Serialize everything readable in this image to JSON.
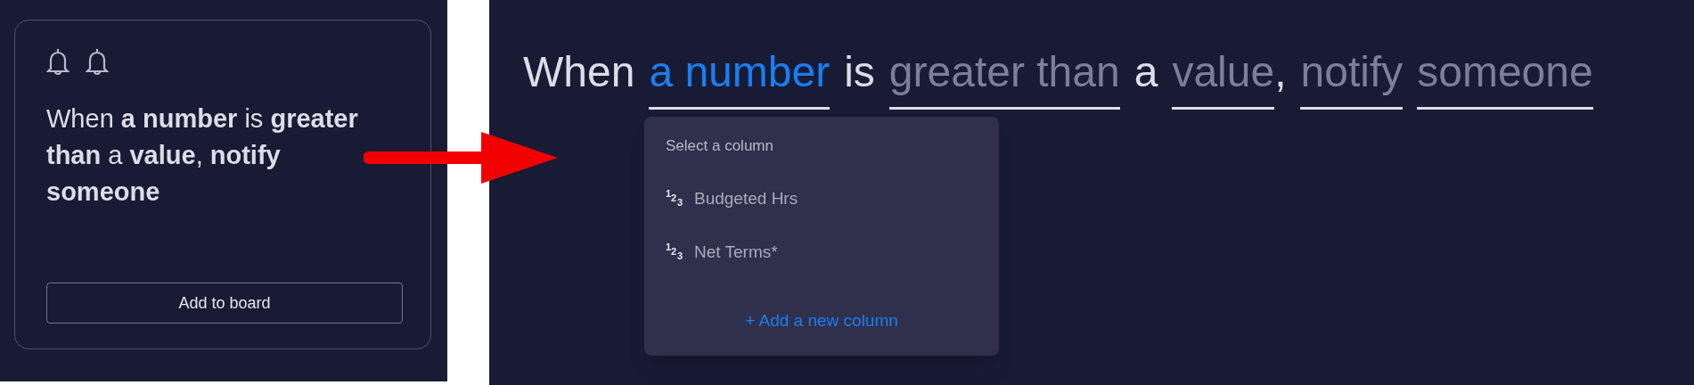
{
  "recipe_card": {
    "text": "When **a number** is **greater than** a **value**, **notify someone**",
    "button": "Add to board"
  },
  "sentence": [
    {
      "kind": "text",
      "text": "When"
    },
    {
      "kind": "field",
      "text": "a number",
      "selected": true
    },
    {
      "kind": "text",
      "text": "is"
    },
    {
      "kind": "field",
      "text": "greater than",
      "selected": false
    },
    {
      "kind": "text",
      "text": "a"
    },
    {
      "kind": "field",
      "text": "value",
      "suffix": ",",
      "selected": false
    },
    {
      "kind": "field",
      "text": "notify",
      "selected": false
    },
    {
      "kind": "field",
      "text": "someone",
      "selected": false
    }
  ],
  "dropdown": {
    "header": "Select a column",
    "items": [
      {
        "label": "Budgeted Hrs",
        "icon": "123"
      },
      {
        "label": "Net Terms*",
        "icon": "123"
      }
    ],
    "add_link": "+ Add a new column"
  }
}
